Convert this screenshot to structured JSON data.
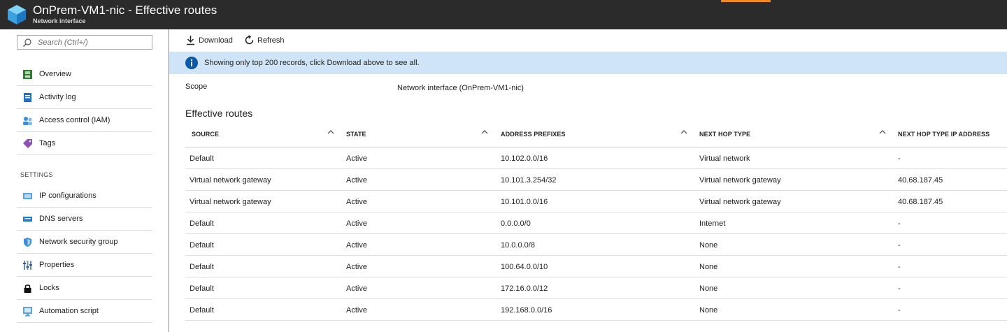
{
  "header": {
    "title": "OnPrem-VM1-nic - Effective routes",
    "subtitle": "Network interface",
    "logo_icon": "network-interface-cube-icon",
    "accent_color": "#f38a1f"
  },
  "sidebar": {
    "search_placeholder": "Search (Ctrl+/)",
    "items": [
      {
        "label": "Overview",
        "icon": "overview-icon"
      },
      {
        "label": "Activity log",
        "icon": "activity-log-icon"
      },
      {
        "label": "Access control (IAM)",
        "icon": "access-control-icon"
      },
      {
        "label": "Tags",
        "icon": "tag-icon"
      }
    ],
    "settings_heading": "SETTINGS",
    "settings_items": [
      {
        "label": "IP configurations",
        "icon": "ip-configurations-icon"
      },
      {
        "label": "DNS servers",
        "icon": "dns-servers-icon"
      },
      {
        "label": "Network security group",
        "icon": "shield-icon"
      },
      {
        "label": "Properties",
        "icon": "properties-icon"
      },
      {
        "label": "Locks",
        "icon": "lock-icon"
      },
      {
        "label": "Automation script",
        "icon": "automation-script-icon"
      }
    ]
  },
  "toolbar": {
    "download_label": "Download",
    "refresh_label": "Refresh"
  },
  "info": {
    "message": "Showing only top 200 records, click Download above to see all."
  },
  "scope": {
    "label": "Scope",
    "value": "Network interface (OnPrem-VM1-nic)"
  },
  "routes": {
    "title": "Effective routes",
    "columns": [
      "SOURCE",
      "STATE",
      "ADDRESS PREFIXES",
      "NEXT HOP TYPE",
      "NEXT HOP TYPE IP ADDRESS"
    ],
    "rows": [
      [
        "Default",
        "Active",
        "10.102.0.0/16",
        "Virtual network",
        "-"
      ],
      [
        "Virtual network gateway",
        "Active",
        "10.101.3.254/32",
        "Virtual network gateway",
        "40.68.187.45"
      ],
      [
        "Virtual network gateway",
        "Active",
        "10.101.0.0/16",
        "Virtual network gateway",
        "40.68.187.45"
      ],
      [
        "Default",
        "Active",
        "0.0.0.0/0",
        "Internet",
        "-"
      ],
      [
        "Default",
        "Active",
        "10.0.0.0/8",
        "None",
        "-"
      ],
      [
        "Default",
        "Active",
        "100.64.0.0/10",
        "None",
        "-"
      ],
      [
        "Default",
        "Active",
        "172.16.0.0/12",
        "None",
        "-"
      ],
      [
        "Default",
        "Active",
        "192.168.0.0/16",
        "None",
        "-"
      ]
    ]
  }
}
